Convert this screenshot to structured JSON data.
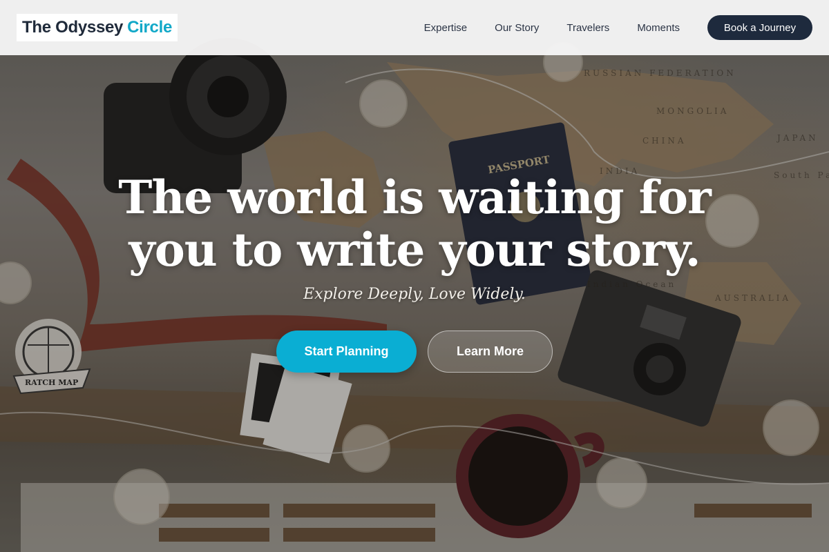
{
  "header": {
    "logo_main": "The Odyssey",
    "logo_accent": "Circle",
    "nav": [
      {
        "label": "Expertise"
      },
      {
        "label": "Our Story"
      },
      {
        "label": "Travelers"
      },
      {
        "label": "Moments"
      }
    ],
    "cta_label": "Book a Journey"
  },
  "hero": {
    "headline": "The world is waiting for you to write your story.",
    "subheadline": "Explore Deeply, Love Widely.",
    "primary_cta": "Start Planning",
    "secondary_cta": "Learn More"
  },
  "background": {
    "map_labels": [
      "RUSSIAN FEDERATION",
      "MONGOLIA",
      "CHINA",
      "JAPAN",
      "INDIA",
      "AUSTRALIA",
      "Indian Ocean",
      "South Pacific Oc"
    ],
    "passport_text": "PASSPORT",
    "scratch_map_text": "RATCH MAP"
  },
  "colors": {
    "brand_dark": "#1e2a3d",
    "brand_accent": "#11a8c8",
    "primary_button": "#0aaed3"
  }
}
